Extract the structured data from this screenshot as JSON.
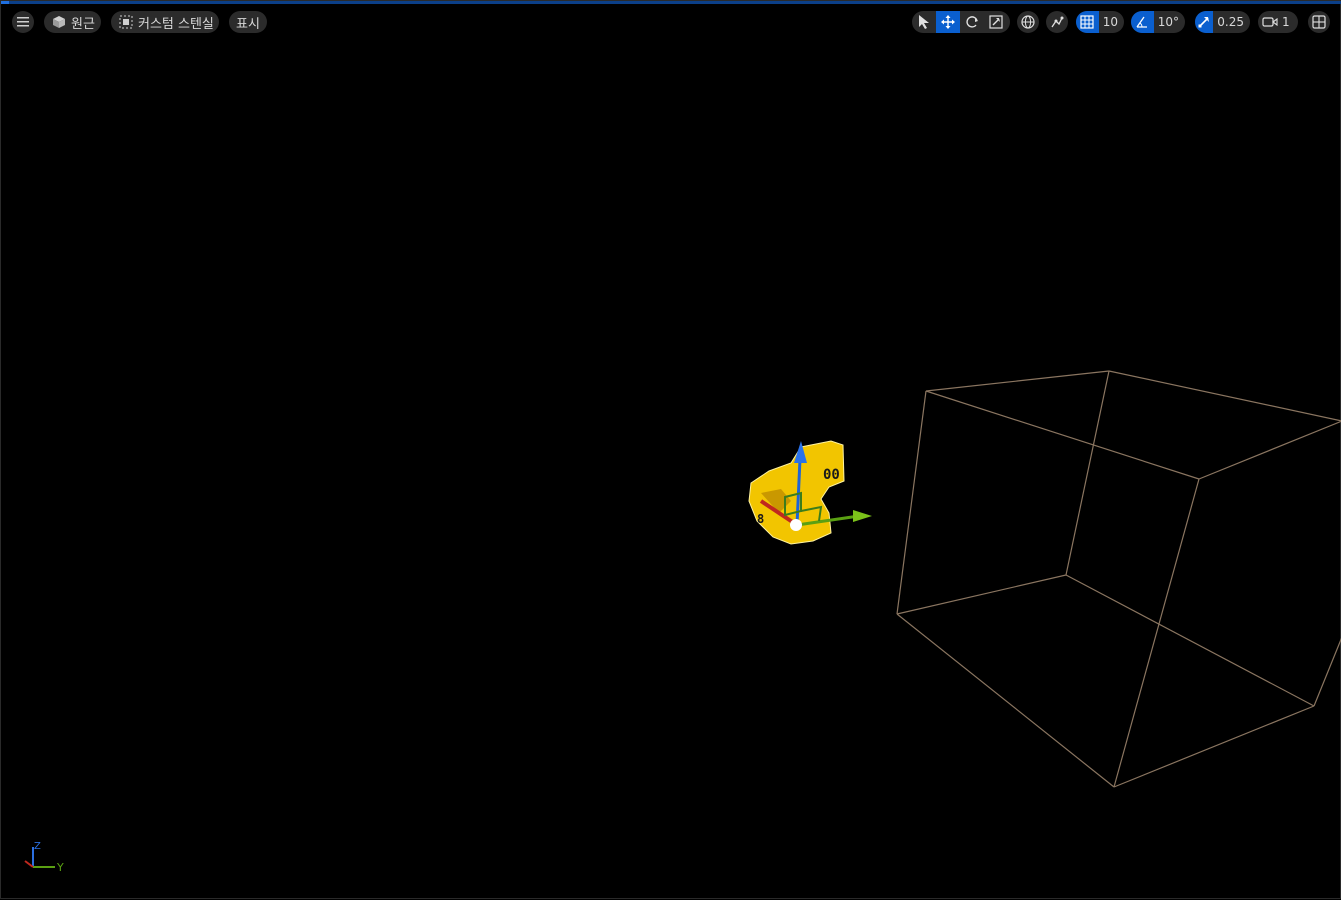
{
  "toolbar": {
    "left": {
      "menu_icon": "hamburger-icon",
      "perspective_label": "원근",
      "viewmode_label": "커스텀 스텐실",
      "show_label": "표시"
    },
    "right": {
      "grid_snap_value": "10",
      "rotation_snap_value": "10°",
      "scale_snap_value": "0.25",
      "camera_speed_value": "1"
    }
  },
  "axis_indicator": {
    "z_label": "Z",
    "y_label": "Y"
  },
  "colors": {
    "accent": "#0a5fcf",
    "toolbar_bg": "#2b2b2b",
    "wireframe": "#8a7560",
    "selection": "#f5c400"
  }
}
